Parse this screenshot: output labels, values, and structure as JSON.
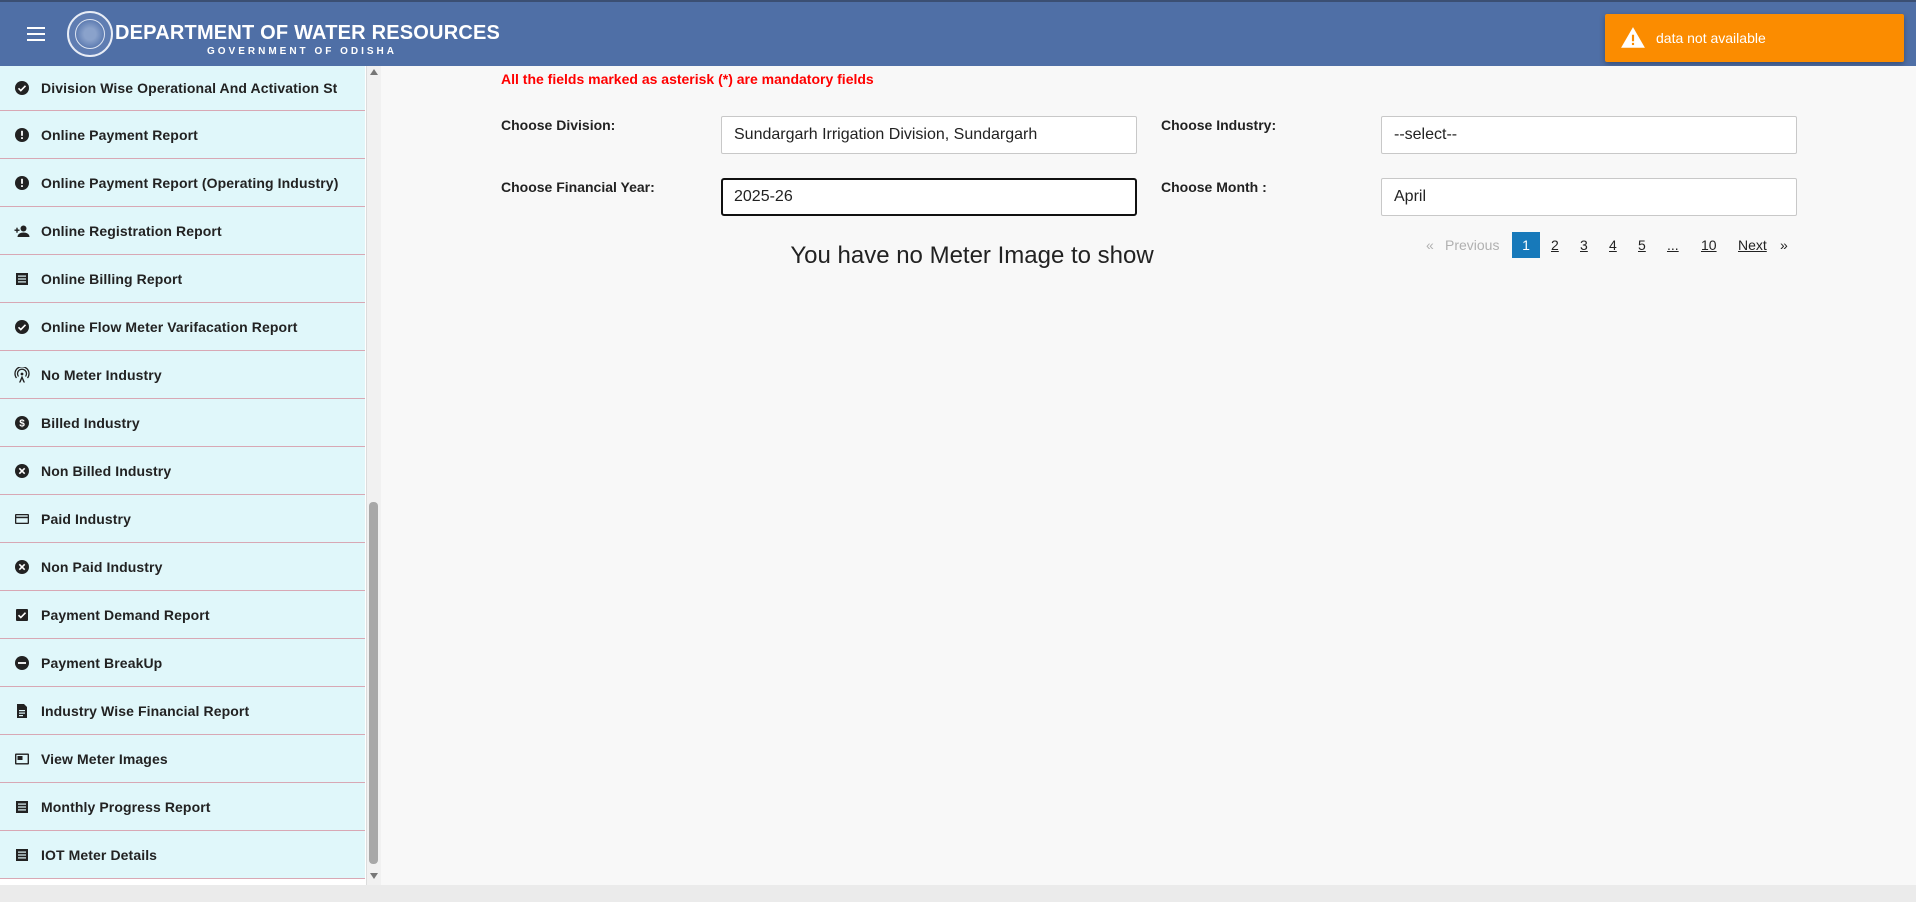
{
  "header": {
    "title": "DEPARTMENT OF WATER RESOURCES",
    "subtitle": "GOVERNMENT OF ODISHA"
  },
  "toast": {
    "message": "data not available",
    "color": "#fb8c00"
  },
  "sidebar": {
    "items": [
      {
        "label": "Division Wise Operational And Activation St",
        "icon": "check-circle-icon"
      },
      {
        "label": "Online Payment Report",
        "icon": "alert-circle-icon"
      },
      {
        "label": "Online Payment Report (Operating Industry)",
        "icon": "alert-circle-icon"
      },
      {
        "label": "Online Registration Report",
        "icon": "person-add-icon"
      },
      {
        "label": "Online Billing Report",
        "icon": "list-icon"
      },
      {
        "label": "Online Flow Meter Varifacation Report",
        "icon": "check-circle-icon"
      },
      {
        "label": "No Meter Industry",
        "icon": "signal-tower-icon"
      },
      {
        "label": "Billed Industry",
        "icon": "dollar-circle-icon"
      },
      {
        "label": "Non Billed Industry",
        "icon": "cancel-circle-icon"
      },
      {
        "label": "Paid Industry",
        "icon": "credit-card-icon"
      },
      {
        "label": "Non Paid Industry",
        "icon": "cancel-circle-icon"
      },
      {
        "label": "Payment Demand Report",
        "icon": "checkbox-icon"
      },
      {
        "label": "Payment BreakUp",
        "icon": "minus-circle-icon"
      },
      {
        "label": "Industry Wise Financial Report",
        "icon": "document-icon"
      },
      {
        "label": "View Meter Images",
        "icon": "image-icon"
      },
      {
        "label": "Monthly Progress Report",
        "icon": "list-icon"
      },
      {
        "label": "IOT Meter Details",
        "icon": "list-icon"
      }
    ]
  },
  "form": {
    "mandatory_note": "All the fields marked as asterisk (*) are mandatory fields",
    "division_label": "Choose Division:",
    "division_value": "Sundargarh Irrigation Division, Sundargarh",
    "industry_label": "Choose Industry:",
    "industry_value": "--select--",
    "year_label": "Choose Financial Year:",
    "year_value": "2025-26",
    "month_label": "Choose Month :",
    "month_value": "April"
  },
  "empty_message": "You have no Meter Image to show",
  "pagination": {
    "prev_arrow": "«",
    "previous": "Previous",
    "pages": [
      "1",
      "2",
      "3",
      "4",
      "5",
      "...",
      "10"
    ],
    "current_page": "1",
    "next": "Next",
    "next_arrow": "»"
  },
  "colors": {
    "header": "#4f6fa6",
    "sidebar_bg": "#e0f7fa",
    "mandatory": "#ff0000",
    "page_active": "#1779ba"
  }
}
